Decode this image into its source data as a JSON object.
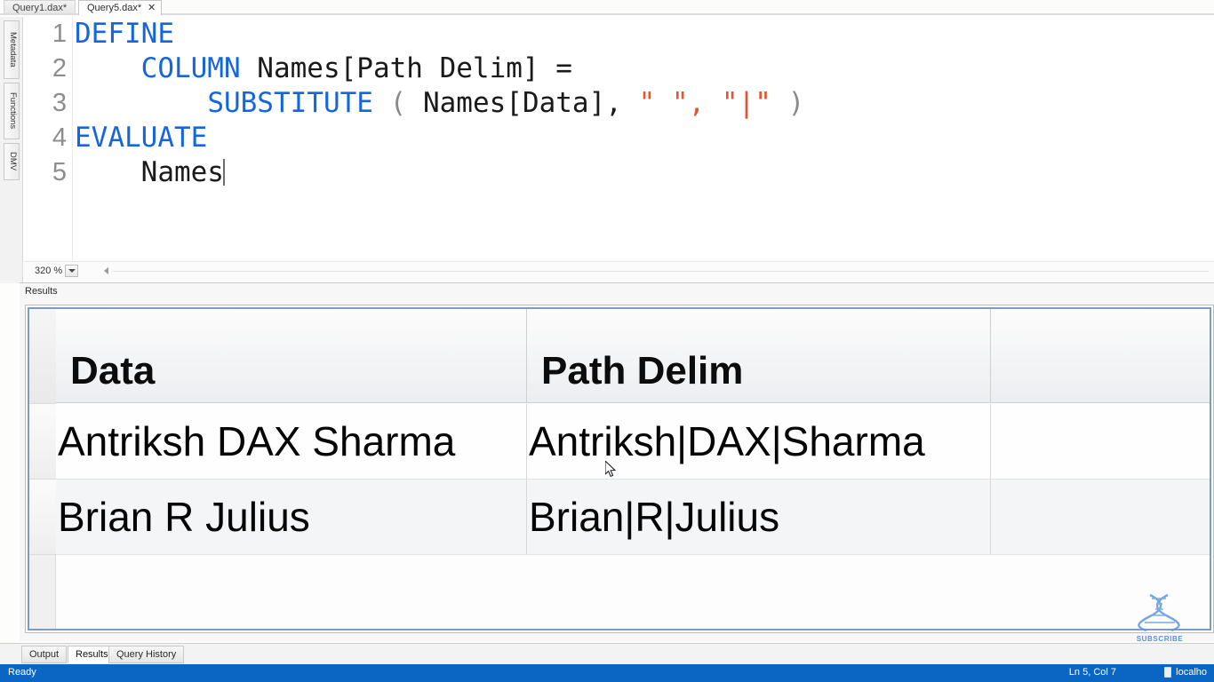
{
  "window": {
    "tabs": [
      {
        "label": "Query1.dax*",
        "active": false,
        "closable": false
      },
      {
        "label": "Query5.dax*",
        "active": true,
        "closable": true,
        "close_glyph": "✕"
      }
    ]
  },
  "sidebar": {
    "items": [
      {
        "label": "Metadata"
      },
      {
        "label": "Functions"
      },
      {
        "label": "DMV"
      }
    ]
  },
  "editor": {
    "lines": [
      {
        "number": "1",
        "tokens": [
          {
            "text": "DEFINE",
            "kind": "kw"
          }
        ]
      },
      {
        "number": "2",
        "tokens": [
          {
            "text": "    ",
            "kind": "plain"
          },
          {
            "text": "COLUMN",
            "kind": "kw"
          },
          {
            "text": " Names[Path Delim] =",
            "kind": "ident"
          }
        ]
      },
      {
        "number": "3",
        "tokens": [
          {
            "text": "        ",
            "kind": "plain"
          },
          {
            "text": "SUBSTITUTE",
            "kind": "kw"
          },
          {
            "text": " ",
            "kind": "plain"
          },
          {
            "text": "(",
            "kind": "punc"
          },
          {
            "text": " Names[Data],",
            "kind": "ident"
          },
          {
            "text": " \" \",",
            "kind": "str"
          },
          {
            "text": " \"|\"",
            "kind": "str"
          },
          {
            "text": " )",
            "kind": "punc"
          }
        ]
      },
      {
        "number": "4",
        "tokens": [
          {
            "text": "EVALUATE",
            "kind": "kw"
          }
        ]
      },
      {
        "number": "5",
        "tokens": [
          {
            "text": "    ",
            "kind": "plain"
          },
          {
            "text": "Names",
            "kind": "ident"
          }
        ]
      }
    ],
    "zoom_level": "320 %"
  },
  "results": {
    "caption": "Results",
    "columns": [
      "Data",
      "Path Delim",
      ""
    ],
    "rows": [
      [
        "Antriksh DAX Sharma",
        "Antriksh|DAX|Sharma",
        ""
      ],
      [
        "Brian R Julius",
        "Brian|R|Julius",
        ""
      ]
    ]
  },
  "bottom_tabs": [
    {
      "label": "Output",
      "active": false
    },
    {
      "label": "Results",
      "active": true
    },
    {
      "label": "Query History",
      "active": false
    }
  ],
  "statusbar": {
    "state": "Ready",
    "line_col": "Ln 5, Col 7",
    "server": "localho"
  },
  "watermark": {
    "label": "SUBSCRIBE"
  },
  "colors": {
    "keyword": "#1565dd",
    "string": "#e8522e",
    "status_bar": "#0a66c2",
    "grid_border": "#7c9cc4"
  }
}
